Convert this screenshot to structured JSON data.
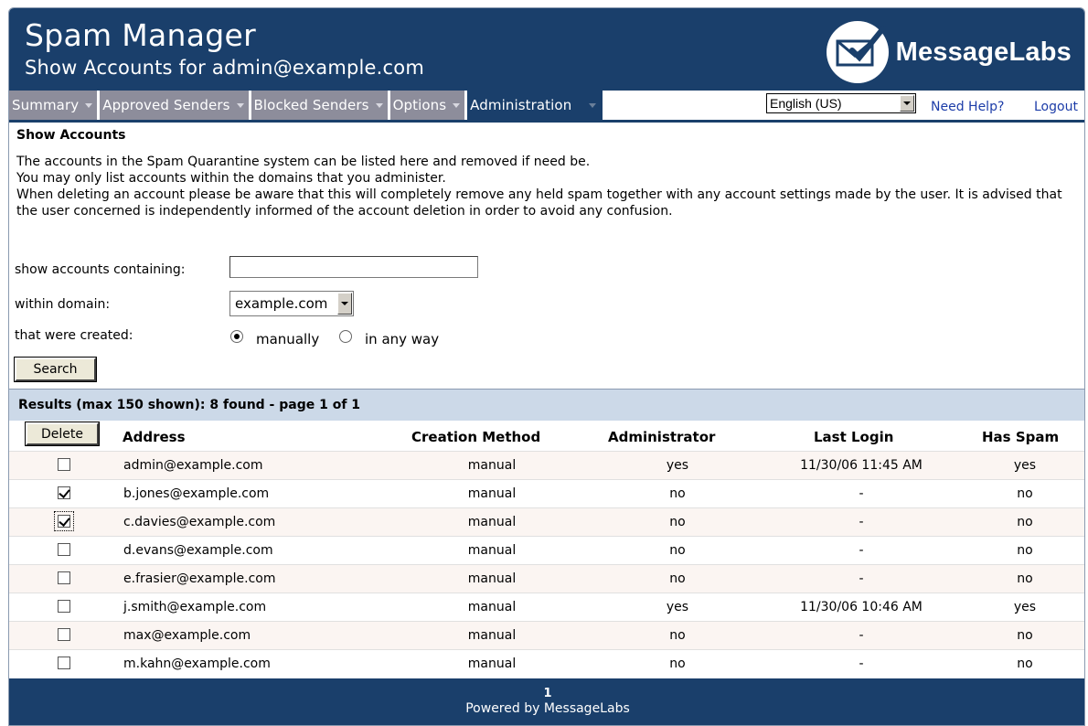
{
  "header": {
    "title": "Spam Manager",
    "subtitle": "Show Accounts for admin@example.com",
    "logo_text": "MessageLabs"
  },
  "nav": {
    "tabs": [
      {
        "label": "Summary",
        "active": false
      },
      {
        "label": "Approved Senders",
        "active": false
      },
      {
        "label": "Blocked Senders",
        "active": false
      },
      {
        "label": "Options",
        "active": false
      },
      {
        "label": "Administration",
        "active": true
      }
    ],
    "language": "English (US)",
    "help_link": "Need Help?",
    "logout_link": "Logout"
  },
  "content": {
    "section_title": "Show Accounts",
    "intro": [
      "The accounts in the Spam Quarantine system can be listed here and removed if need be.",
      "You may only list accounts within the domains that you administer.",
      "When deleting an account please be aware that this will completely remove any held spam together with any account settings made by the user. It is advised that the user concerned is independently informed of the account deletion in order to avoid any confusion."
    ],
    "form": {
      "containing_label": "show accounts containing:",
      "containing_value": "",
      "domain_label": "within domain:",
      "domain_value": "example.com",
      "created_label": "that were created:",
      "option_manual": "manually",
      "option_any": "in any way",
      "selected_option": "manually",
      "search_button": "Search"
    }
  },
  "results": {
    "summary": "Results (max 150 shown): 8 found - page 1 of 1",
    "delete_button": "Delete",
    "columns": [
      "Address",
      "Creation Method",
      "Administrator",
      "Last Login",
      "Has Spam"
    ],
    "rows": [
      {
        "checked": false,
        "address": "admin@example.com",
        "method": "manual",
        "admin": "yes",
        "last_login": "11/30/06 11:45 AM",
        "has_spam": "yes"
      },
      {
        "checked": true,
        "address": "b.jones@example.com",
        "method": "manual",
        "admin": "no",
        "last_login": "-",
        "has_spam": "no"
      },
      {
        "checked": true,
        "address": "c.davies@example.com",
        "method": "manual",
        "admin": "no",
        "last_login": "-",
        "has_spam": "no"
      },
      {
        "checked": false,
        "address": "d.evans@example.com",
        "method": "manual",
        "admin": "no",
        "last_login": "-",
        "has_spam": "no"
      },
      {
        "checked": false,
        "address": "e.frasier@example.com",
        "method": "manual",
        "admin": "no",
        "last_login": "-",
        "has_spam": "no"
      },
      {
        "checked": false,
        "address": "j.smith@example.com",
        "method": "manual",
        "admin": "yes",
        "last_login": "11/30/06 10:46 AM",
        "has_spam": "yes"
      },
      {
        "checked": false,
        "address": "max@example.com",
        "method": "manual",
        "admin": "no",
        "last_login": "-",
        "has_spam": "no"
      },
      {
        "checked": false,
        "address": "m.kahn@example.com",
        "method": "manual",
        "admin": "no",
        "last_login": "-",
        "has_spam": "no"
      }
    ]
  },
  "footer": {
    "page": "1",
    "powered_by": "Powered by MessageLabs"
  },
  "colors": {
    "brand_navy": "#1a3f6b",
    "tab_gray": "#8d8d9b",
    "results_header_bg": "#ccd9e8",
    "row_alt_bg": "#fbf5f2",
    "link_blue": "#1c3ca8"
  },
  "icons": {
    "logo": "envelope-check-icon",
    "nav_dropdown": "chevron-down-icon"
  }
}
